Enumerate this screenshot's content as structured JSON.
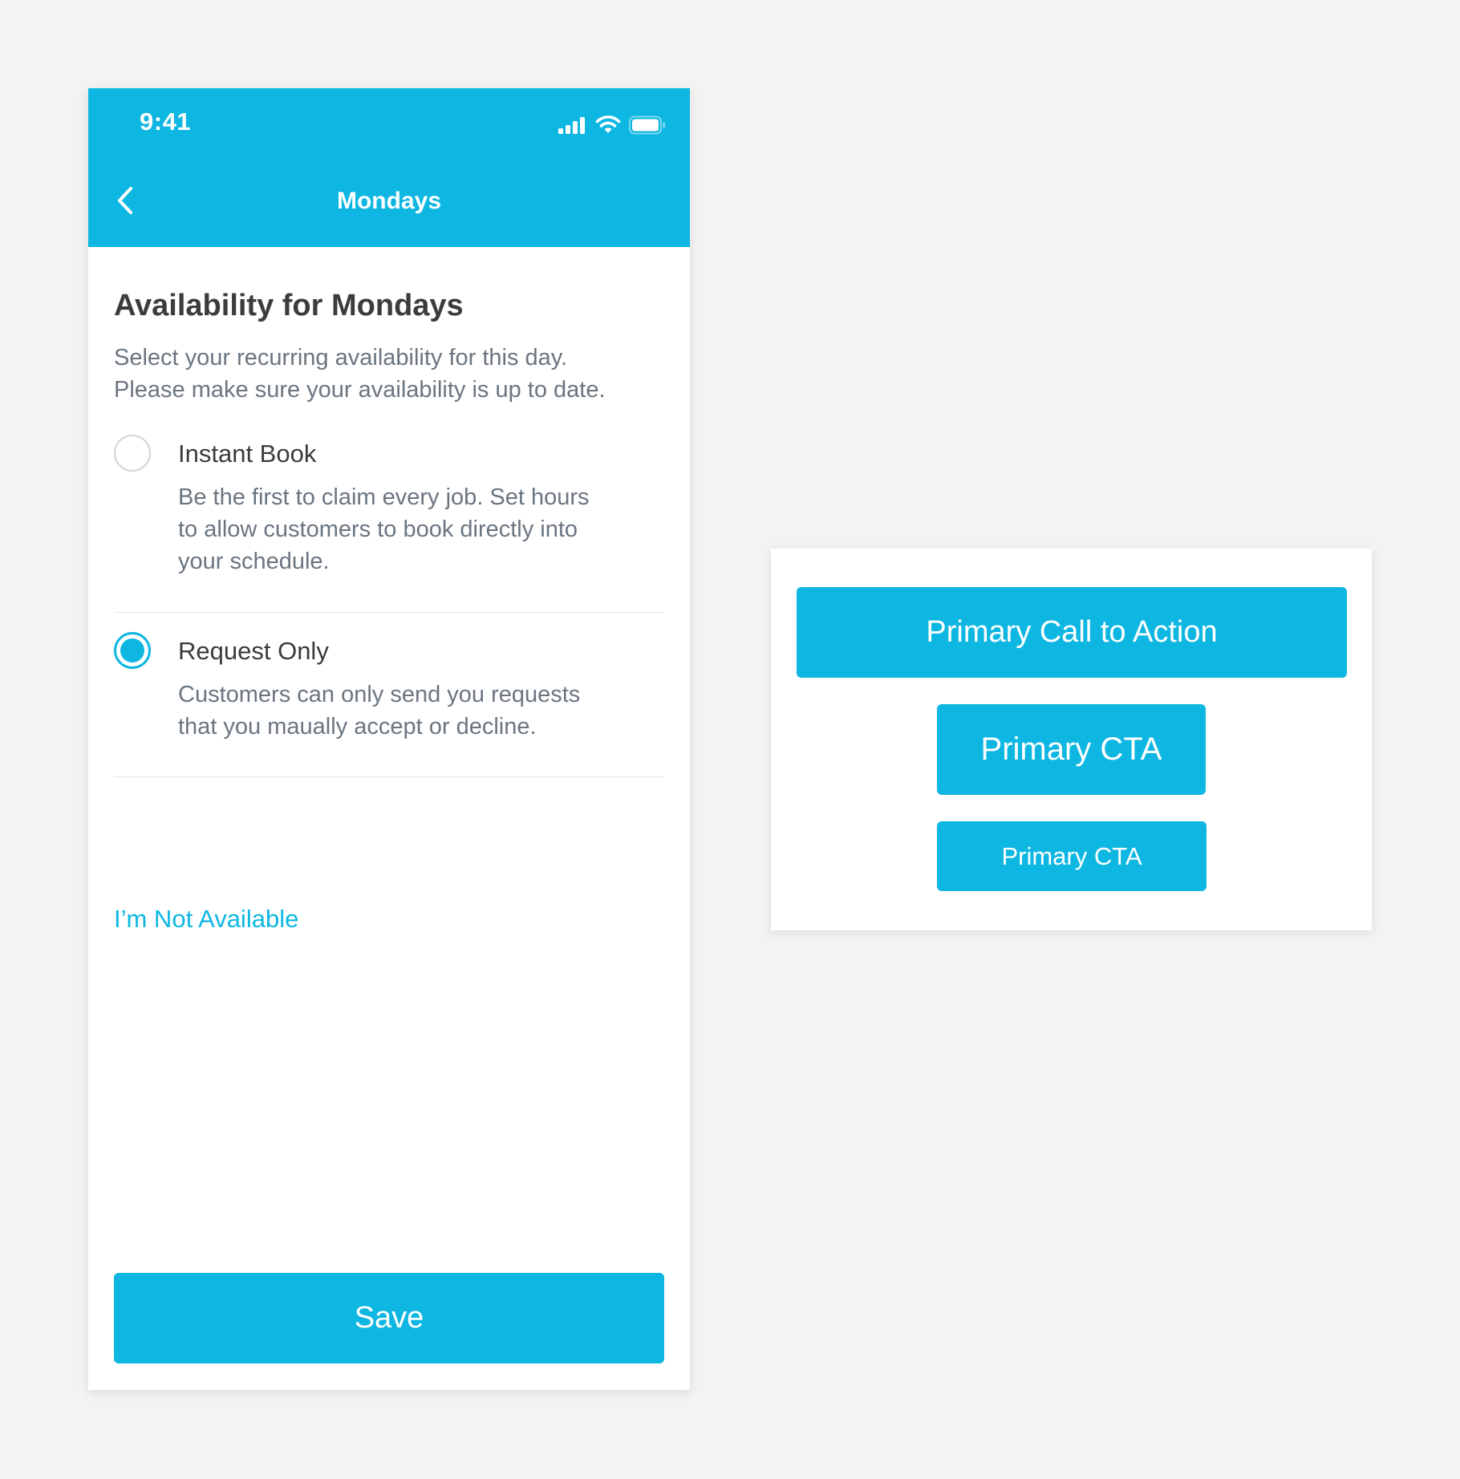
{
  "colors": {
    "accent": "#0db7e2",
    "background": "#f3f3f3",
    "heading_text": "#3c3c3c",
    "body_text": "#6b7580",
    "divider": "#e3e6e9"
  },
  "status_bar": {
    "time": "9:41",
    "icons": [
      "cellular-signal-icon",
      "wifi-icon",
      "battery-icon"
    ]
  },
  "nav": {
    "back_icon": "chevron-left-icon",
    "title": "Mondays"
  },
  "section": {
    "title": "Availability for Mondays",
    "description_lines": [
      "Select your recurring availability for this day.",
      "Please make sure your availability is up to date."
    ]
  },
  "options": [
    {
      "title": "Instant Book",
      "selected": false,
      "description_lines": [
        "Be the first to claim every job. Set hours",
        "to allow customers to book directly into",
        "your schedule."
      ]
    },
    {
      "title": "Request Only",
      "selected": true,
      "description_lines": [
        "Customers can only send you requests",
        "that you maually accept or decline."
      ]
    }
  ],
  "not_available_link": "I’m Not Available",
  "save_button": "Save",
  "cta_examples": {
    "large": "Primary Call to Action",
    "medium": "Primary CTA",
    "small": "Primary CTA"
  }
}
